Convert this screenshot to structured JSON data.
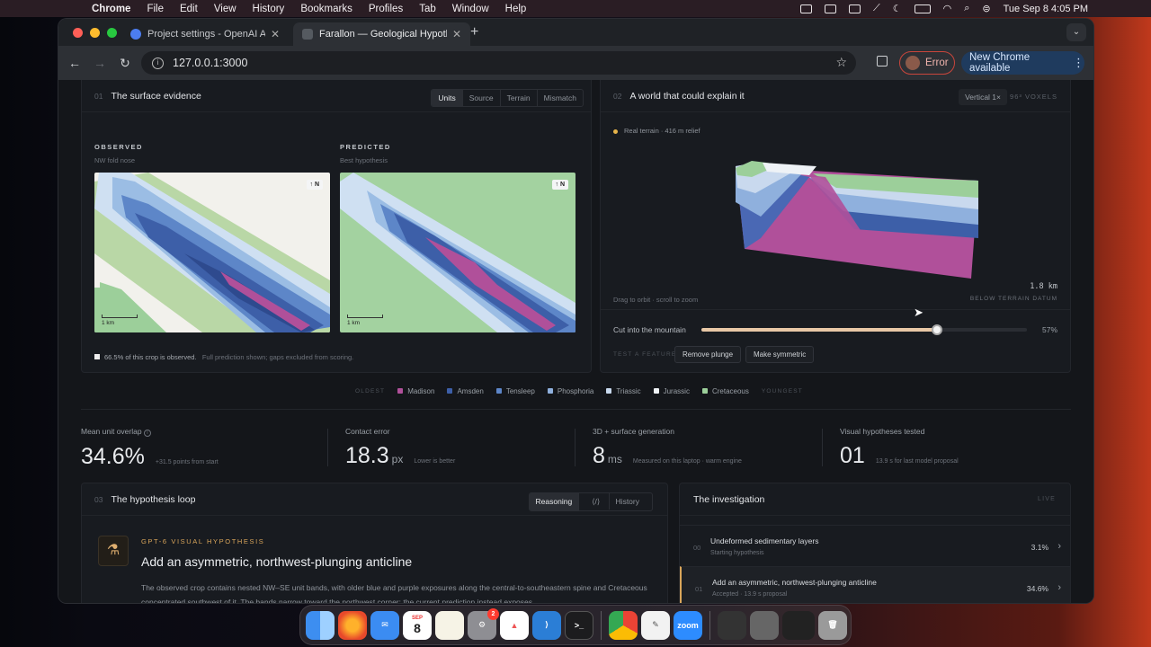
{
  "menubar": {
    "app": "Chrome",
    "items": [
      "File",
      "Edit",
      "View",
      "History",
      "Bookmarks",
      "Profiles",
      "Tab",
      "Window",
      "Help"
    ],
    "clock": "Tue Sep 8  4:05 PM"
  },
  "browser": {
    "tabs": [
      {
        "label": "Project settings - OpenAI API",
        "favicon_color": "#4c7df0"
      },
      {
        "label": "Farallon — Geological Hypoth",
        "favicon_color": "#555a60"
      }
    ],
    "url": "127.0.0.1:3000",
    "error_label": "Error",
    "update_label": "New Chrome available"
  },
  "surface": {
    "num": "01",
    "title": "The surface evidence",
    "segments": [
      "Units",
      "Source",
      "Terrain",
      "Mismatch"
    ],
    "active_segment": "Units",
    "observed_label": "OBSERVED",
    "observed_sub": "NW fold nose",
    "predicted_label": "PREDICTED",
    "predicted_sub": "Best hypothesis",
    "north": "↑ N",
    "scale": "1 km",
    "note_main": "66.5% of this crop is observed.",
    "note_rest": "Full prediction shown; gaps excluded from scoring."
  },
  "world": {
    "num": "02",
    "title": "A world that could explain it",
    "vertical": "Vertical 1×",
    "voxels": "96³ VOXELS",
    "terrain_chip": "Real terrain · 416 m relief",
    "depth": "1.8 km",
    "orbit_hint": "Drag to orbit · scroll to zoom",
    "datum": "BELOW TERRAIN DATUM",
    "slider_label": "Cut into the mountain",
    "slider_value": "57%",
    "slider_fraction": 0.57,
    "test_label": "TEST A FEATURE",
    "btn_plunge": "Remove plunge",
    "btn_symmetric": "Make symmetric"
  },
  "legend": {
    "oldest": "OLDEST",
    "youngest": "YOUNGEST",
    "units": [
      {
        "name": "Madison",
        "color": "#b0509a"
      },
      {
        "name": "Amsden",
        "color": "#3d5fa8"
      },
      {
        "name": "Tensleep",
        "color": "#5d86c8"
      },
      {
        "name": "Phosphoria",
        "color": "#8fb0dd"
      },
      {
        "name": "Triassic",
        "color": "#c9d9ee"
      },
      {
        "name": "Jurassic",
        "color": "#eef2f6"
      },
      {
        "name": "Cretaceous",
        "color": "#9ccf9a"
      }
    ]
  },
  "stats": [
    {
      "label": "Mean unit overlap",
      "value": "34.6%",
      "unit": "",
      "hint": "+31.5 points from start"
    },
    {
      "label": "Contact error",
      "value": "18.3",
      "unit": "px",
      "hint": "Lower is better"
    },
    {
      "label": "3D + surface generation",
      "value": "8",
      "unit": "ms",
      "hint": "Measured on this laptop · warm engine"
    },
    {
      "label": "Visual hypotheses tested",
      "value": "01",
      "unit": "",
      "hint": "13.9 s for last model proposal"
    }
  ],
  "loop": {
    "num": "03",
    "title": "The hypothesis loop",
    "tab_reasoning": "Reasoning",
    "tab_history": "History",
    "kicker": "GPT-6 VISUAL HYPOTHESIS",
    "headline": "Add an asymmetric, northwest-plunging anticline",
    "body": "The observed crop contains nested NW–SE unit bands, with older blue and purple exposures along the central-to-southeastern spine and Cretaceous concentrated southwest of it. The bands narrow toward the northwest corner; the current prediction instead exposes"
  },
  "investigation": {
    "title": "The investigation",
    "live": "LIVE",
    "rows": [
      {
        "n": "00",
        "title": "Undeformed sedimentary layers",
        "sub": "Starting hypothesis",
        "pct": "3.1%"
      },
      {
        "n": "01",
        "title": "Add an asymmetric, northwest-plunging anticline",
        "sub": "Accepted · 13.9 s proposal",
        "pct": "34.6%"
      }
    ]
  },
  "dock": {
    "calendar_month": "SEP",
    "calendar_day": "8",
    "zoom_label": "zoom",
    "badge": "2"
  }
}
